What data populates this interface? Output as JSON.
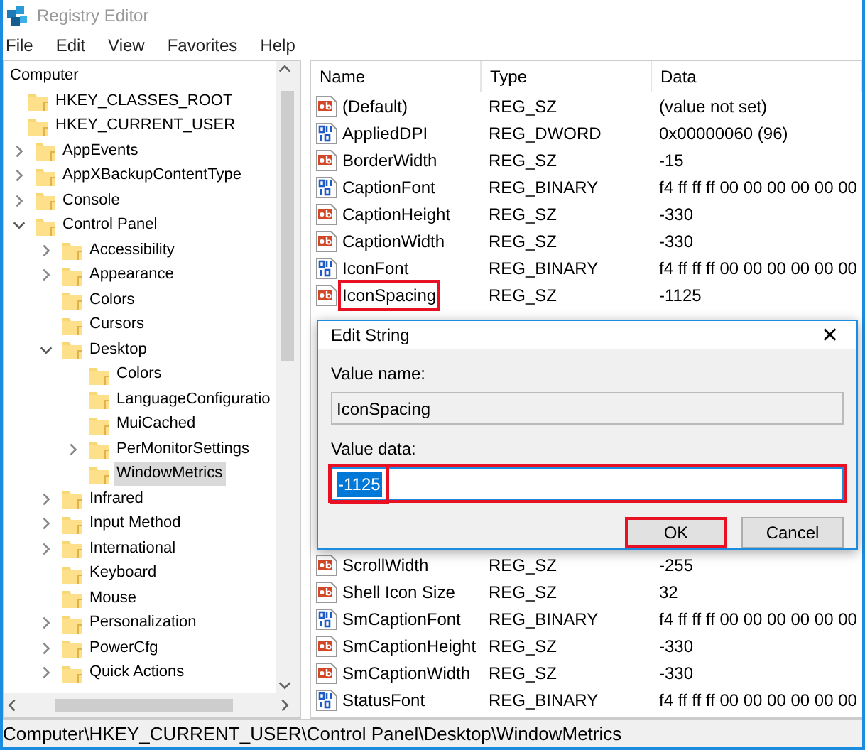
{
  "window": {
    "title": "Registry Editor"
  },
  "menu": [
    "File",
    "Edit",
    "View",
    "Favorites",
    "Help"
  ],
  "tree": [
    {
      "label": "Computer",
      "selected": false,
      "children": [
        {
          "label": "HKEY_CLASSES_ROOT",
          "selected": false
        },
        {
          "label": "HKEY_CURRENT_USER",
          "selected": false,
          "children": [
            {
              "label": "AppEvents",
              "selected": false,
              "expanded": false
            },
            {
              "label": "AppXBackupContentType",
              "selected": false,
              "expanded": false
            },
            {
              "label": "Console",
              "selected": false,
              "expanded": false
            },
            {
              "label": "Control Panel",
              "selected": false,
              "expanded": true,
              "children": [
                {
                  "label": "Accessibility",
                  "selected": false,
                  "expanded": false
                },
                {
                  "label": "Appearance",
                  "selected": false,
                  "expanded": false
                },
                {
                  "label": "Colors",
                  "selected": false
                },
                {
                  "label": "Cursors",
                  "selected": false
                },
                {
                  "label": "Desktop",
                  "selected": false,
                  "expanded": true,
                  "children": [
                    {
                      "label": "Colors",
                      "selected": false
                    },
                    {
                      "label": "LanguageConfiguratio",
                      "selected": false
                    },
                    {
                      "label": "MuiCached",
                      "selected": false
                    },
                    {
                      "label": "PerMonitorSettings",
                      "selected": false,
                      "expanded": false
                    },
                    {
                      "label": "WindowMetrics",
                      "selected": true
                    }
                  ]
                },
                {
                  "label": "Infrared",
                  "selected": false,
                  "expanded": false
                },
                {
                  "label": "Input Method",
                  "selected": false,
                  "expanded": false
                },
                {
                  "label": "International",
                  "selected": false,
                  "expanded": false
                },
                {
                  "label": "Keyboard",
                  "selected": false
                },
                {
                  "label": "Mouse",
                  "selected": false
                },
                {
                  "label": "Personalization",
                  "selected": false,
                  "expanded": false
                },
                {
                  "label": "PowerCfg",
                  "selected": false,
                  "expanded": false
                },
                {
                  "label": "Quick Actions",
                  "selected": false,
                  "expanded": false
                }
              ]
            }
          ]
        }
      ]
    }
  ],
  "values": {
    "columns": [
      "Name",
      "Type",
      "Data"
    ],
    "rows_above": [
      {
        "kind": "string",
        "name": "(Default)",
        "type": "REG_SZ",
        "data": "(value not set)",
        "highlighted": false
      },
      {
        "kind": "binary",
        "name": "AppliedDPI",
        "type": "REG_DWORD",
        "data": "0x00000060 (96)",
        "highlighted": false
      },
      {
        "kind": "string",
        "name": "BorderWidth",
        "type": "REG_SZ",
        "data": "-15",
        "highlighted": false
      },
      {
        "kind": "binary",
        "name": "CaptionFont",
        "type": "REG_BINARY",
        "data": "f4 ff ff ff 00 00 00 00 00 00",
        "highlighted": false
      },
      {
        "kind": "string",
        "name": "CaptionHeight",
        "type": "REG_SZ",
        "data": "-330",
        "highlighted": false
      },
      {
        "kind": "string",
        "name": "CaptionWidth",
        "type": "REG_SZ",
        "data": "-330",
        "highlighted": false
      },
      {
        "kind": "binary",
        "name": "IconFont",
        "type": "REG_BINARY",
        "data": "f4 ff ff ff 00 00 00 00 00 00",
        "highlighted": false
      },
      {
        "kind": "string",
        "name": "IconSpacing",
        "type": "REG_SZ",
        "data": "-1125",
        "highlighted": true
      }
    ],
    "rows_below": [
      {
        "kind": "string",
        "name": "ScrollWidth",
        "type": "REG_SZ",
        "data": "-255",
        "highlighted": false
      },
      {
        "kind": "string",
        "name": "Shell Icon Size",
        "type": "REG_SZ",
        "data": "32",
        "highlighted": false
      },
      {
        "kind": "binary",
        "name": "SmCaptionFont",
        "type": "REG_BINARY",
        "data": "f4 ff ff ff 00 00 00 00 00 00",
        "highlighted": false
      },
      {
        "kind": "string",
        "name": "SmCaptionHeight",
        "type": "REG_SZ",
        "data": "-330",
        "highlighted": false
      },
      {
        "kind": "string",
        "name": "SmCaptionWidth",
        "type": "REG_SZ",
        "data": "-330",
        "highlighted": false
      },
      {
        "kind": "binary",
        "name": "StatusFont",
        "type": "REG_BINARY",
        "data": "f4 ff ff ff 00 00 00 00 00 00",
        "highlighted": false
      }
    ]
  },
  "dialog": {
    "title": "Edit String",
    "close": "✕",
    "name_label": "Value name:",
    "name_value": "IconSpacing",
    "data_label": "Value data:",
    "data_value": "-1125",
    "data_highlighted": true,
    "buttons": [
      {
        "label": "OK",
        "focused": true,
        "highlighted": true
      },
      {
        "label": "Cancel",
        "focused": false,
        "highlighted": false
      }
    ]
  },
  "status_bar": "Computer\\HKEY_CURRENT_USER\\Control Panel\\Desktop\\WindowMetrics"
}
